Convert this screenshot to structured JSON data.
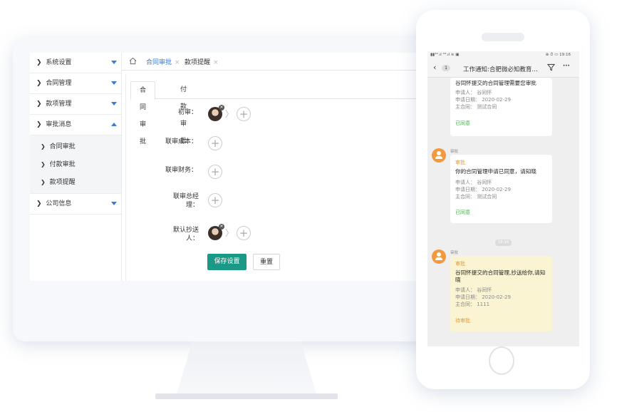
{
  "colors": {
    "accent": "#1a9a86",
    "link": "#3a7bd5",
    "approved": "#4caf50",
    "pending": "#e09a3d"
  },
  "sidebar": {
    "items": [
      {
        "label": "系统设置",
        "caret": "down"
      },
      {
        "label": "合同管理",
        "caret": "down"
      },
      {
        "label": "款项管理",
        "caret": "down"
      },
      {
        "label": "审批消息",
        "caret": "up"
      }
    ],
    "sub_items": [
      "合同审批",
      "付款审批",
      "款项提醒"
    ],
    "last_item": {
      "label": "公司信息",
      "caret": "down"
    }
  },
  "tabbar": {
    "home_icon": "home-icon",
    "tabs": [
      {
        "label": "合同审批",
        "active": true
      },
      {
        "label": "款项提醒",
        "active": false
      }
    ],
    "close_glyph": "×"
  },
  "content": {
    "tabs": [
      {
        "label": "合同审批",
        "active": true
      },
      {
        "label": "付款审批",
        "active": false
      }
    ],
    "rows": [
      {
        "label": "初审：",
        "has_avatar": true
      },
      {
        "label": "联审成本：",
        "has_avatar": false
      },
      {
        "label": "联审财务：",
        "has_avatar": false
      },
      {
        "label": "联审总经理：",
        "has_avatar": false
      },
      {
        "label": "默认抄送人：",
        "has_avatar": true
      }
    ],
    "add_glyph": "+",
    "save_button": "保存设置",
    "reset_button": "重置"
  },
  "phone": {
    "status_left": "▮▮⁴ᴳ.ıl ⁴ᴳ.ıl ≋ ▣",
    "status_right": "⊕ ⏱ ▭ 19:16",
    "back_badge": "1",
    "title": "工作通知:合肥微必知教育…",
    "filter_icon": "filter-icon",
    "more": "···",
    "messages": [
      {
        "sender": "",
        "tag": "",
        "title": "谷同怀提交的合同管理需要您审批",
        "applicant": "申请人：  谷同怀",
        "date": "申请日期：  2020-02-29",
        "contract": "主合同：  测试合同",
        "status": "已同意",
        "status_color": "#4caf50"
      },
      {
        "sender": "审批",
        "tag": "审批",
        "title": "你的合同管理申请已同意，请知晓",
        "applicant": "申请人：  谷同怀",
        "date": "申请日期：  2020-02-29",
        "contract": "主合同：  测试合同",
        "status": "已同意",
        "status_color": "#4caf50"
      },
      {
        "sender": "审批",
        "tag": "审批",
        "title": "谷同怀提交的合同管理,抄送给你,请知晓",
        "applicant": "申请人：  谷同怀",
        "date": "申请日期：  2020-02-29",
        "contract": "主合同：  1111",
        "status": "待审批",
        "status_color": "#e09a3d"
      }
    ],
    "time_pill": "19:16"
  }
}
